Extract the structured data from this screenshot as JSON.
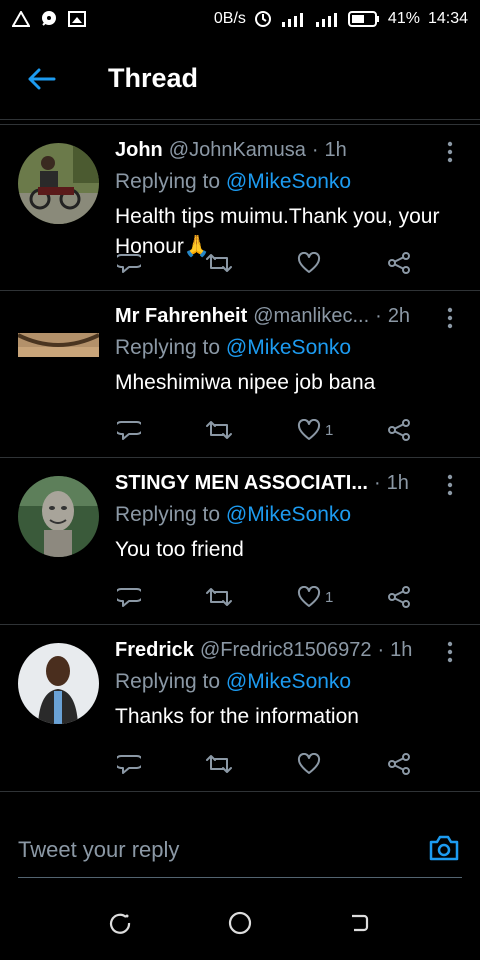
{
  "status": {
    "speed": "0B/s",
    "battery": "41%",
    "time": "14:34"
  },
  "header": {
    "title": "Thread"
  },
  "tweets": [
    {
      "name": "John",
      "handle": "@JohnKamusa",
      "time": "1h",
      "replying_prefix": "Replying to",
      "replying_to": "@MikeSonko",
      "text": "Health tips muimu.Thank you, your Honour🙏",
      "like_count": ""
    },
    {
      "name": "Mr Fahrenheit",
      "handle": "@manlikec...",
      "time": "2h",
      "replying_prefix": "Replying to",
      "replying_to": "@MikeSonko",
      "text": "Mheshimiwa nipee job bana",
      "like_count": "1"
    },
    {
      "name": "STINGY MEN ASSOCIATI...",
      "handle": "",
      "time": "1h",
      "replying_prefix": "Replying to",
      "replying_to": "@MikeSonko",
      "text": "You too friend",
      "like_count": "1"
    },
    {
      "name": "Fredrick",
      "handle": "@Fredric81506972",
      "time": "1h",
      "replying_prefix": "Replying to",
      "replying_to": "@MikeSonko",
      "text": "Thanks for the information",
      "like_count": ""
    }
  ],
  "reply": {
    "placeholder": "Tweet your reply"
  },
  "colors": {
    "accent": "#1d9bf0",
    "muted": "#8b98a5",
    "background": "#000000",
    "divider": "#2f3336"
  }
}
